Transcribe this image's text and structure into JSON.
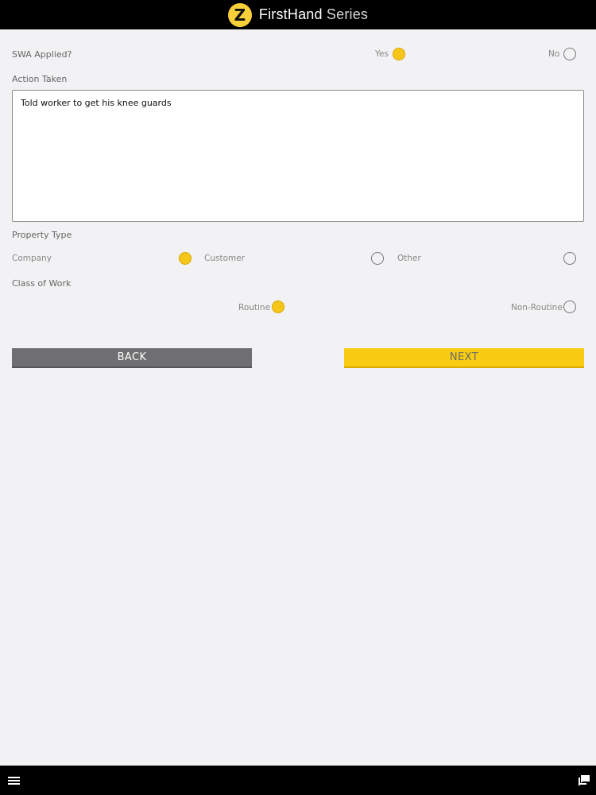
{
  "header": {
    "logo_letter": "Z",
    "brand_bold": "FirstHand",
    "brand_light": " Series"
  },
  "swa": {
    "label": "SWA Applied?",
    "options": [
      {
        "label": "Yes",
        "selected": true
      },
      {
        "label": "No",
        "selected": false
      }
    ]
  },
  "action": {
    "label": "Action Taken",
    "value": "Told worker to get his knee guards"
  },
  "property": {
    "label": "Property Type",
    "options": [
      {
        "label": "Company",
        "selected": true
      },
      {
        "label": "Customer",
        "selected": false
      },
      {
        "label": "Other",
        "selected": false
      }
    ]
  },
  "work_class": {
    "label": "Class of Work",
    "options": [
      {
        "label": "Routine",
        "selected": true
      },
      {
        "label": "Non-Routine",
        "selected": false
      }
    ]
  },
  "buttons": {
    "back": "BACK",
    "next": "NEXT"
  },
  "colors": {
    "accent": "#f5c518",
    "bar": "#000000",
    "back_button": "#6f6f71"
  },
  "icons": {
    "menu": "hamburger-menu-icon",
    "chat": "chat-icon"
  }
}
